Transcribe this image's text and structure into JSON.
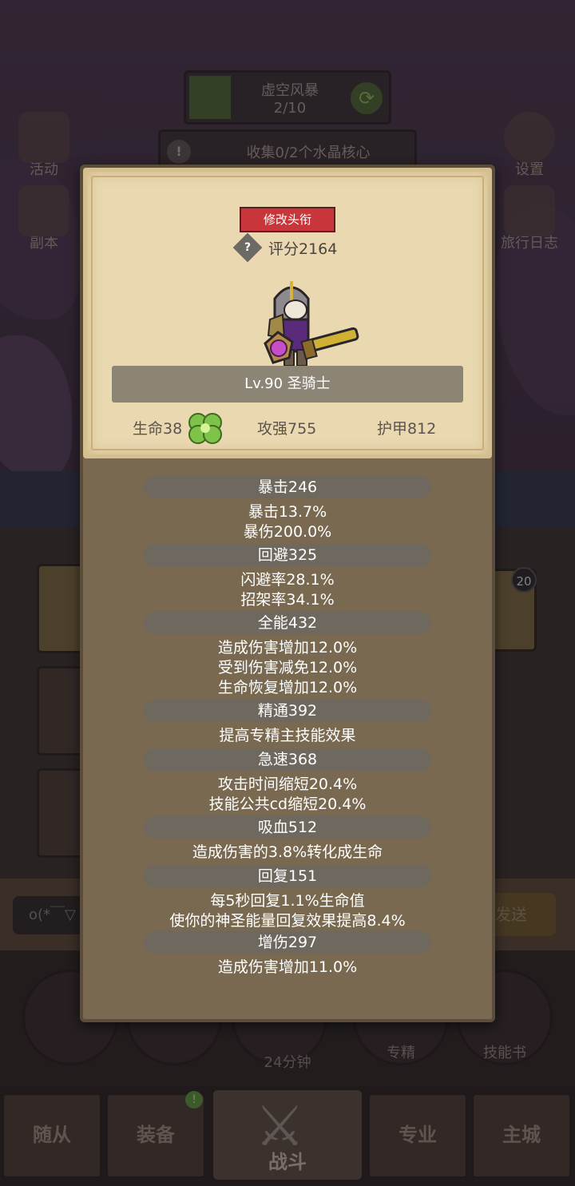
{
  "background": {
    "quest": {
      "title": "虚空风暴",
      "progress": "2/10"
    },
    "collect_text": "收集0/2个水晶核心",
    "side_left": [
      "活动",
      "副本"
    ],
    "side_right": [
      "设置",
      "旅行日志"
    ],
    "badge": "20",
    "chat_placeholder": "o(*￣▽",
    "send_label": "发送",
    "round_buttons": [
      "专精",
      "技能书"
    ],
    "timer": "24分钟"
  },
  "nav": {
    "items": [
      "随从",
      "装备",
      "战斗",
      "专业",
      "主城"
    ]
  },
  "card": {
    "rename_label": "修改头衔",
    "score_icon": "?",
    "score": "评分2164",
    "level": "Lv.90 圣骑士",
    "stats": [
      "生命38",
      "攻强755",
      "护甲812"
    ]
  },
  "sections": [
    {
      "header": "暴击246",
      "lines": [
        "暴击13.7%",
        "暴伤200.0%"
      ]
    },
    {
      "header": "回避325",
      "lines": [
        "闪避率28.1%",
        "招架率34.1%"
      ]
    },
    {
      "header": "全能432",
      "lines": [
        "造成伤害增加12.0%",
        "受到伤害减免12.0%",
        "生命恢复增加12.0%"
      ]
    },
    {
      "header": "精通392",
      "lines": [
        "提高专精主技能效果"
      ]
    },
    {
      "header": "急速368",
      "lines": [
        "攻击时间缩短20.4%",
        "技能公共cd缩短20.4%"
      ]
    },
    {
      "header": "吸血512",
      "lines": [
        "造成伤害的3.8%转化成生命"
      ]
    },
    {
      "header": "回复151",
      "lines": [
        "每5秒回复1.1%生命值",
        "使你的神圣能量回复效果提高8.4%"
      ]
    },
    {
      "header": "增伤297",
      "lines": [
        "造成伤害增加11.0%"
      ]
    }
  ]
}
